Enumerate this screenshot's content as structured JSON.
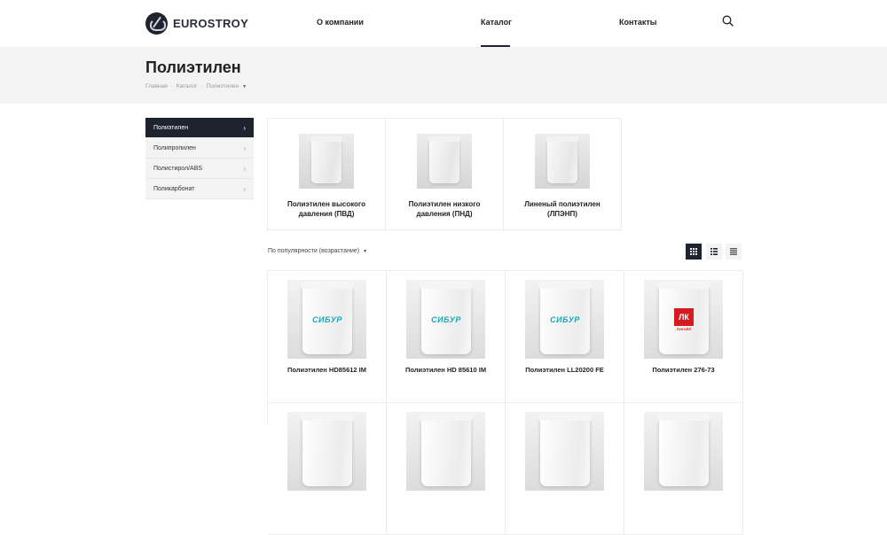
{
  "header": {
    "logo_text": "EUROSTROY",
    "nav": [
      "О компании",
      "Каталог",
      "Контакты"
    ]
  },
  "page": {
    "title": "Полиэтилен",
    "breadcrumb": [
      "Главная",
      "Каталог",
      "Полиэтилен"
    ]
  },
  "sidebar": {
    "items": [
      {
        "label": "Полиэтилен",
        "active": true
      },
      {
        "label": "Полипропилен",
        "active": false
      },
      {
        "label": "Полистирол/ABS",
        "active": false
      },
      {
        "label": "Поликарбонат",
        "active": false
      }
    ]
  },
  "subcategories": [
    {
      "label": "Полиэтилен высокого давления (ПВД)"
    },
    {
      "label": "Полиэтилен низкого давления (ПНД)"
    },
    {
      "label": "Линеный полиэтилен (ЛПЭНП)"
    }
  ],
  "sort": {
    "label": "По популярности (возрастание)"
  },
  "view_modes": [
    "grid",
    "list",
    "table"
  ],
  "active_view": "grid",
  "products": [
    {
      "name": "Полиэтилен HD85612 IM",
      "brand": "СИБУР"
    },
    {
      "name": "Полиэтилен HD 85610 IM",
      "brand": "СИБУР"
    },
    {
      "name": "Полиэтилен LL20200 FE",
      "brand": "СИБУР"
    },
    {
      "name": "Полиэтилен 276-73",
      "brand": "ЛУКОЙЛ"
    }
  ],
  "colors": {
    "accent": "#1f2330",
    "sibur": "#17a7b8",
    "lukoil": "#d71920",
    "band": "#f3f3f3"
  }
}
